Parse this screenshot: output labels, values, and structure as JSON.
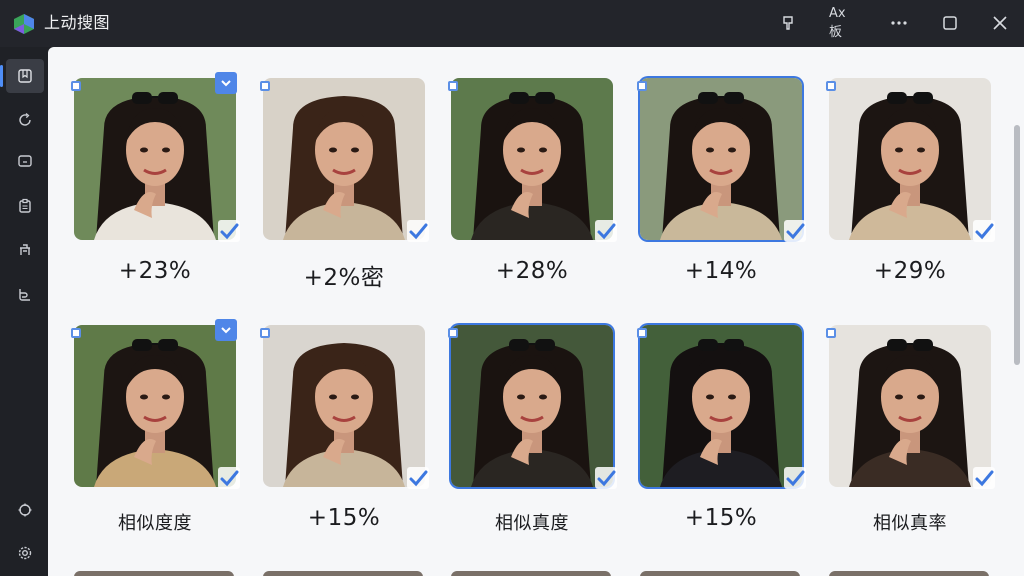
{
  "app": {
    "title": "上动搜图",
    "toolbar": {
      "pin_icon": "pin-icon",
      "filter_label": "Ax 板",
      "more_icon": "more-horizontal-icon",
      "maximize_icon": "maximize-icon",
      "close_icon": "close-icon"
    }
  },
  "sidebar": {
    "items": [
      {
        "icon": "gallery-icon",
        "active": true
      },
      {
        "icon": "refresh-icon",
        "active": false
      },
      {
        "icon": "monitor-icon",
        "active": false
      },
      {
        "icon": "clipboard-icon",
        "active": false
      },
      {
        "icon": "bench-icon",
        "active": false
      },
      {
        "icon": "tag-icon",
        "active": false
      }
    ],
    "bottom_items": [
      {
        "icon": "plugin-icon"
      },
      {
        "icon": "settings-icon"
      }
    ]
  },
  "grid": {
    "rows": [
      {
        "cards": [
          {
            "label": "+23%",
            "selected": false,
            "badge": true,
            "bg": "#6f8a5a",
            "hair": "#1c1512",
            "top": "#e9e4dc",
            "glasses": true
          },
          {
            "label": "+2%密",
            "selected": false,
            "badge": false,
            "bg": "#d8d2c8",
            "hair": "#3a2418",
            "top": "#c7b59a",
            "glasses": false
          },
          {
            "label": "+28%",
            "selected": false,
            "badge": false,
            "bg": "#5d7a4c",
            "hair": "#1a1310",
            "top": "#2a2622",
            "glasses": true
          },
          {
            "label": "+14%",
            "selected": true,
            "badge": false,
            "bg": "#8a9a7c",
            "hair": "#1a1310",
            "top": "#c9b89a",
            "glasses": true
          },
          {
            "label": "+29%",
            "selected": false,
            "badge": false,
            "bg": "#e5e2dd",
            "hair": "#1c1512",
            "top": "#cfb99a",
            "glasses": true
          }
        ]
      },
      {
        "cards": [
          {
            "label": "相似度度",
            "selected": false,
            "badge": true,
            "bg": "#5f7a48",
            "hair": "#1c1512",
            "top": "#c9a878",
            "glasses": true
          },
          {
            "label": "+15%",
            "selected": false,
            "badge": false,
            "bg": "#d9d5cf",
            "hair": "#3a2418",
            "top": "#c7b59a",
            "glasses": false
          },
          {
            "label": "相似真度",
            "selected": true,
            "badge": false,
            "bg": "#44583a",
            "hair": "#1a1310",
            "top": "#2a2622",
            "glasses": true
          },
          {
            "label": "+15%",
            "selected": true,
            "badge": false,
            "bg": "#43603a",
            "hair": "#141010",
            "top": "#1e1d22",
            "glasses": true
          },
          {
            "label": "相似真率",
            "selected": false,
            "badge": false,
            "bg": "#e6e3de",
            "hair": "#1c1512",
            "top": "#3a2c24",
            "glasses": true
          }
        ]
      }
    ]
  }
}
